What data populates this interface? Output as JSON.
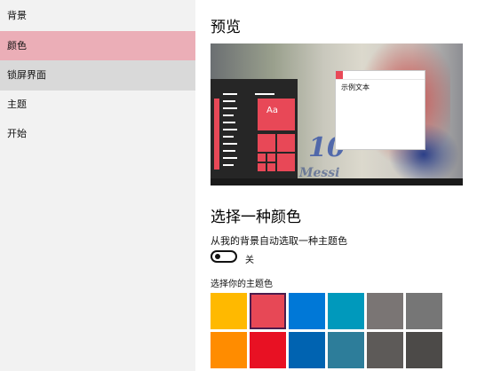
{
  "sidebar": {
    "items": [
      {
        "label": "背景"
      },
      {
        "label": "颜色"
      },
      {
        "label": "锁屏界面"
      },
      {
        "label": "主题"
      },
      {
        "label": "开始"
      }
    ]
  },
  "main": {
    "preview_title": "预览",
    "sample_text": "示例文本",
    "tile_label": "Aa",
    "wallpaper_number": "10",
    "wallpaper_name": "Messi",
    "choose_color_title": "选择一种颜色",
    "auto_pick_label": "从我的背景自动选取一种主题色",
    "auto_pick_state": "关",
    "choose_theme_color_label": "选择你的主题色"
  },
  "colors": {
    "accent": "#e84857",
    "sidebar_selected": "#ebaeb7",
    "swatches": [
      "#ffb900",
      "#e74856",
      "#0078d7",
      "#0099bc",
      "#7a7574",
      "#767676",
      "#ff8c00",
      "#e81123",
      "#0063b1",
      "#2d7d9a",
      "#5d5a58",
      "#4c4a48"
    ],
    "selected_swatch_index": 1
  }
}
